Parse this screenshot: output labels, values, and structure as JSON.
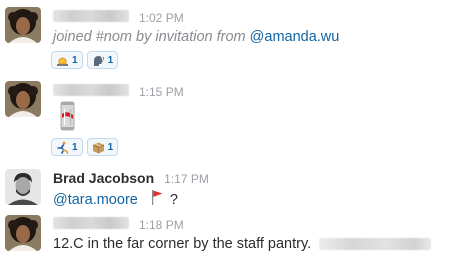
{
  "messages": [
    {
      "author_redacted": true,
      "time": "1:02 PM",
      "system_prefix": "joined #nom by invitation from ",
      "mention": "@amanda.wu",
      "reactions": [
        {
          "icon": "rotating-light-icon",
          "count": "1"
        },
        {
          "icon": "speaking-head-icon",
          "count": "1"
        }
      ]
    },
    {
      "author_redacted": true,
      "time": "1:15 PM",
      "attachment_icon": "diet-coke-can-icon",
      "reactions": [
        {
          "icon": "runner-icon",
          "count": "1"
        },
        {
          "icon": "package-icon",
          "count": "1"
        }
      ]
    },
    {
      "author": "Brad Jacobson",
      "time": "1:17 PM",
      "mention": "@tara.moore",
      "flag_icon": "triangular-flag-icon",
      "suffix": "?"
    },
    {
      "author_redacted": true,
      "time": "1:18 PM",
      "text": "12.C in the far corner by the staff pantry."
    }
  ],
  "colors": {
    "mention": "#1264a3",
    "timestamp": "#9e9ea6",
    "system_text": "#8a8a90",
    "reaction_bg": "#f2f7fc",
    "reaction_border": "#c3d9ee"
  }
}
